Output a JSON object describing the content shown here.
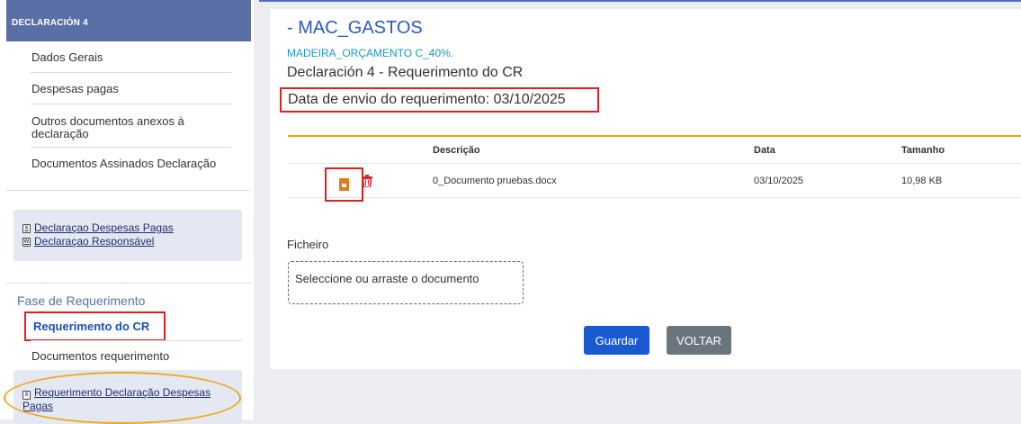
{
  "sidebar": {
    "header": "DECLARACIÓN 4",
    "items": [
      {
        "label": "Dados Gerais"
      },
      {
        "label": "Despesas pagas"
      },
      {
        "label": "Outros documentos anexos à declaração"
      },
      {
        "label": "Documentos Assinados Declaração"
      }
    ],
    "doc_links": [
      {
        "label": "Declaraçao Despesas Pagas ",
        "icon": "excel-file-icon"
      },
      {
        "label": "Declaraçao Responsável ",
        "icon": "word-file-icon"
      }
    ],
    "fase_title": "Fase de Requerimento",
    "active_item": "Requerimento do CR",
    "docs_requerimento": "Documentos requerimento",
    "bottom_link": {
      "label": "Requerimento Declaração Despesas Pagas ",
      "icon": "excel-file-icon"
    }
  },
  "main": {
    "title": "- MAC_GASTOS",
    "subtitle": "MADEIRA_ORÇAMENTO C_40%.",
    "decl_title": "Declaración 4 - Requerimento do CR",
    "data_envio": "Data de envio do requerimento: 03/10/2025",
    "table": {
      "headers": [
        "Descrição",
        "Data",
        "Tamanho"
      ],
      "rows": [
        {
          "descricao": "0_Documento pruebas.docx",
          "data": "03/10/2025",
          "tamanho": "10,98 KB"
        }
      ]
    },
    "ficheiro_label": "Ficheiro",
    "dropzone_text": "Seleccione ou arraste o documento",
    "buttons": {
      "guardar": "Guardar",
      "voltar": "VOLTAR"
    }
  },
  "colors": {
    "sidebar_header": "#5a6fa7",
    "accent_blue": "#1a5ad1",
    "title_blue": "#2b58c3",
    "highlight_red": "#e02020",
    "highlight_orange": "#f0a81e",
    "table_top_border": "#f0a200"
  }
}
